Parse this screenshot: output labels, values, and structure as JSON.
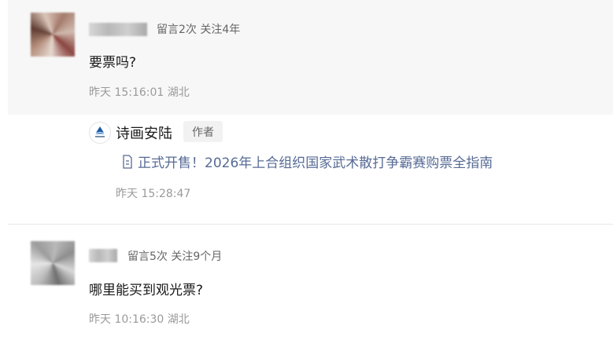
{
  "comments": [
    {
      "meta": "留言2次 关注4年",
      "content": "要票吗?",
      "time": "昨天 15:16:01 湖北",
      "reply": {
        "author": "诗画安陆",
        "badge": "作者",
        "link_text": "正式开售！2026年上合组织国家武术散打争霸赛购票全指南",
        "time": "昨天 15:28:47"
      }
    },
    {
      "meta": "留言5次 关注9个月",
      "content": "哪里能买到观光票?",
      "time": "昨天 10:16:30 湖北"
    }
  ],
  "colors": {
    "link": "#576b95",
    "highlight_bg": "#f7f7f7",
    "logo_blue": "#1c5aa6"
  },
  "icons": {
    "link_icon": "document-icon",
    "reply_logo": "site-logo-icon"
  }
}
